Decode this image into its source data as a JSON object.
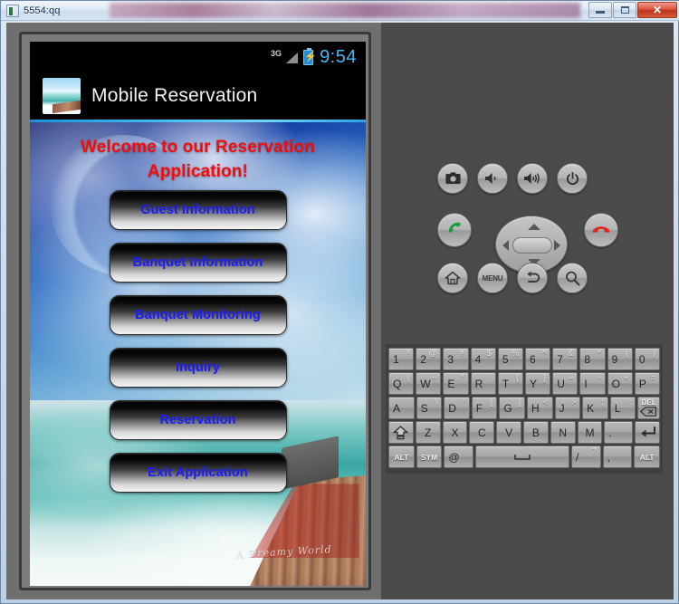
{
  "window": {
    "title": "5554:qq",
    "controls": [
      {
        "name": "minimize",
        "label": "minimize"
      },
      {
        "name": "maximize",
        "label": "maximize"
      },
      {
        "name": "close",
        "label": "✕"
      }
    ]
  },
  "phone": {
    "status_bar": {
      "network": "3G",
      "time": "9:54",
      "battery": "charging",
      "time_color": "#47b8ef"
    },
    "app_bar": {
      "title": "Mobile Reservation",
      "icon": "beach-thumbnail-icon"
    },
    "content": {
      "welcome_line1": "Welcome to our Reservation",
      "welcome_line2": "Application!",
      "welcome_color": "#f60b0b",
      "watermark": "A Dreamy World",
      "buttons": [
        {
          "label": "Guest Information",
          "name": "guest-information"
        },
        {
          "label": "Banquet Information",
          "name": "banquet-information"
        },
        {
          "label": "Banquet Monitoring",
          "name": "banquet-monitoring"
        },
        {
          "label": "Inquiry",
          "name": "inquiry"
        },
        {
          "label": "Reservation",
          "name": "reservation"
        },
        {
          "label": "Exit Application",
          "name": "exit-application"
        }
      ],
      "button_text_color": "#1a1aff"
    }
  },
  "emulator_controls": {
    "row1": [
      {
        "name": "camera-button",
        "icon": "camera-icon"
      },
      {
        "name": "volume-down-button",
        "icon": "volume-down-icon"
      },
      {
        "name": "volume-up-button",
        "icon": "volume-up-icon"
      },
      {
        "name": "power-button",
        "icon": "power-icon"
      }
    ],
    "row2": [
      {
        "name": "call-button",
        "icon": "phone-green-icon"
      },
      {
        "name": "end-call-button",
        "icon": "phone-red-icon"
      }
    ],
    "row3": [
      {
        "name": "home-button",
        "icon": "home-icon"
      },
      {
        "name": "menu-button",
        "icon": "menu-icon",
        "label": "MENU"
      },
      {
        "name": "back-button",
        "icon": "back-arrow-icon"
      },
      {
        "name": "search-button",
        "icon": "magnifier-icon"
      }
    ],
    "dpad": {
      "name": "dpad",
      "directions": [
        "up",
        "down",
        "left",
        "right"
      ],
      "center": "select"
    }
  },
  "keyboard": {
    "rows": [
      [
        {
          "main": "1",
          "sup": "!"
        },
        {
          "main": "2",
          "sup": "@"
        },
        {
          "main": "3",
          "sup": "#"
        },
        {
          "main": "4",
          "sup": "$"
        },
        {
          "main": "5",
          "sup": "%"
        },
        {
          "main": "6",
          "sup": "^"
        },
        {
          "main": "7",
          "sup": "&"
        },
        {
          "main": "8",
          "sup": "*"
        },
        {
          "main": "9",
          "sup": "("
        },
        {
          "main": "0",
          "sup": ")"
        }
      ],
      [
        {
          "main": "Q",
          "sup": "|"
        },
        {
          "main": "W",
          "sup": "~"
        },
        {
          "main": "E",
          "sup": "“"
        },
        {
          "main": "R",
          "sup": "`"
        },
        {
          "main": "T",
          "sup": "{"
        },
        {
          "main": "Y",
          "sup": "}"
        },
        {
          "main": "U",
          "sup": "–"
        },
        {
          "main": "I",
          "sup": "-"
        },
        {
          "main": "O",
          "sup": "+"
        },
        {
          "main": "P",
          "sup": "="
        }
      ],
      [
        {
          "main": "A",
          "sup": ""
        },
        {
          "main": "S",
          "sup": "\\"
        },
        {
          "main": "D",
          "sup": "‘"
        },
        {
          "main": "F",
          "sup": "["
        },
        {
          "main": "G",
          "sup": "]"
        },
        {
          "main": "H",
          "sup": "<"
        },
        {
          "main": "J",
          "sup": ">"
        },
        {
          "main": "K",
          "sup": ";"
        },
        {
          "main": "L",
          "sup": ":"
        },
        {
          "main": "DEL",
          "sup": ""
        }
      ],
      [
        {
          "main": "⇧",
          "sup": ""
        },
        {
          "main": "Z",
          "sup": ""
        },
        {
          "main": "X",
          "sup": ""
        },
        {
          "main": "C",
          "sup": ""
        },
        {
          "main": "V",
          "sup": ""
        },
        {
          "main": "B",
          "sup": ""
        },
        {
          "main": "N",
          "sup": ""
        },
        {
          "main": "M",
          "sup": ""
        },
        {
          "main": ".",
          "sup": ""
        },
        {
          "main": "↵",
          "sup": ""
        }
      ],
      [
        {
          "main": "ALT",
          "sup": ""
        },
        {
          "main": "SYM",
          "sup": ""
        },
        {
          "main": "@",
          "sup": ""
        },
        {
          "main": "␣",
          "sup": ""
        },
        {
          "main": "/",
          "sup": "?"
        },
        {
          "main": ",",
          "sup": ""
        },
        {
          "main": "ALT",
          "sup": ""
        }
      ]
    ]
  }
}
